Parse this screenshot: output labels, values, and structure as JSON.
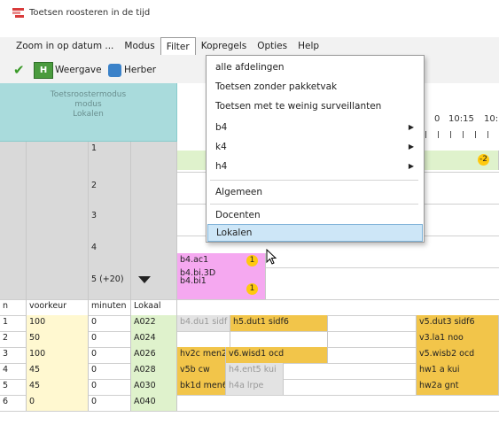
{
  "window": {
    "title": "Toetsen roosteren in de tijd"
  },
  "menubar": {
    "items": [
      "Zoom in op datum ...",
      "Modus",
      "Filter",
      "Kopregels",
      "Opties",
      "Help"
    ]
  },
  "toolbar": {
    "weergave_label": "Weergave",
    "herber_label": "Herber"
  },
  "grid": {
    "corner_lines": [
      "Toetsroostermodus",
      "modus",
      "Lokalen"
    ],
    "time_labels": [
      "0",
      "10:15",
      "10:"
    ],
    "group_rows": [
      {
        "num": "1",
        "bar_value": "-2"
      },
      {
        "num": "2"
      },
      {
        "num": "3"
      },
      {
        "num": "4",
        "slot_lines": [
          "b4.ac1"
        ],
        "badge": "1"
      },
      {
        "num": "5 (+20)",
        "slot_lines": [
          "b4.bi.3D",
          "b4.bi1"
        ],
        "badge": "1"
      }
    ],
    "columns": [
      "n",
      "voorkeur",
      "minuten",
      "Lokaal"
    ],
    "rooms": [
      {
        "n": "1",
        "voorkeur": "100",
        "minuten": "0",
        "lokaal": "A022",
        "slots": [
          "b4.du1 sidf",
          "h5.dut1 sidf6",
          "",
          "v5.dut3 sidf6"
        ]
      },
      {
        "n": "2",
        "voorkeur": "50",
        "minuten": "0",
        "lokaal": "A024",
        "slots": [
          "",
          "",
          "",
          "v3.la1 noo"
        ]
      },
      {
        "n": "3",
        "voorkeur": "100",
        "minuten": "0",
        "lokaal": "A026",
        "slots": [
          "hv2c men2",
          "v6.wisd1 ocd",
          "",
          "v5.wisb2 ocd"
        ]
      },
      {
        "n": "4",
        "voorkeur": "45",
        "minuten": "0",
        "lokaal": "A028",
        "slots": [
          "v5b cw",
          "h4.ent5 kui",
          "",
          "hw1 a kui"
        ]
      },
      {
        "n": "5",
        "voorkeur": "45",
        "minuten": "0",
        "lokaal": "A030",
        "slots": [
          "bk1d men6",
          "h4a lrpe",
          "",
          "hw2a gnt"
        ]
      },
      {
        "n": "6",
        "voorkeur": "0",
        "minuten": "0",
        "lokaal": "A040",
        "slots": [
          "",
          "",
          "",
          ""
        ]
      }
    ]
  },
  "filter_menu": {
    "items": [
      {
        "label": "alle afdelingen",
        "submenu": false
      },
      {
        "label": "Toetsen zonder pakketvak",
        "submenu": false
      },
      {
        "label": "Toetsen met te weinig surveillanten",
        "submenu": false
      },
      {
        "label": "b4",
        "submenu": true
      },
      {
        "label": "k4",
        "submenu": true
      },
      {
        "label": "h4",
        "submenu": true
      },
      {
        "label": "Algemeen",
        "submenu": false
      },
      {
        "label": "Docenten",
        "submenu": false
      },
      {
        "label": "Lokalen",
        "submenu": false,
        "highlighted": true
      }
    ]
  }
}
